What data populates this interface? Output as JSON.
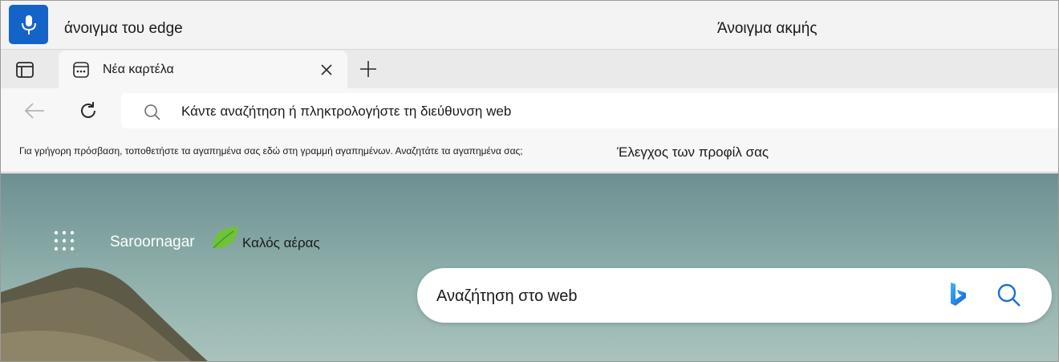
{
  "voice": {
    "mic_icon": "microphone-icon",
    "spoken_text": "άνοιγμα του edge",
    "result_text": "Άνοιγμα ακμής",
    "accent": "#1464c8"
  },
  "tabs": {
    "items": [
      {
        "title": "Νέα καρτέλα",
        "favicon": "new-tab-page-icon"
      }
    ],
    "close_icon": "close-icon",
    "new_tab_icon": "plus-icon",
    "workspaces_icon": "tab-actions-icon"
  },
  "toolbar": {
    "back_icon": "arrow-left-icon",
    "refresh_icon": "refresh-icon",
    "address_placeholder": "Κάντε αναζήτηση ή πληκτρολογήστε τη διεύθυνση web",
    "search_icon": "search-icon"
  },
  "favorites_bar": {
    "hint": "Για γρήγορη πρόσβαση, τοποθετήστε τα αγαπημένα σας εδώ στη γραμμή αγαπημένων. Αναζητάτε τα αγαπημένα σας;",
    "link": "Έλεγχος των προφίλ σας"
  },
  "new_tab_page": {
    "apps_icon": "app-launcher-icon",
    "location": "Saroornagar",
    "weather_icon": "leaf-icon",
    "air_quality": "Καλός αέρας",
    "search_placeholder": "Αναζήτηση στο web",
    "bing_icon": "bing-icon",
    "search_button_icon": "search-icon"
  }
}
